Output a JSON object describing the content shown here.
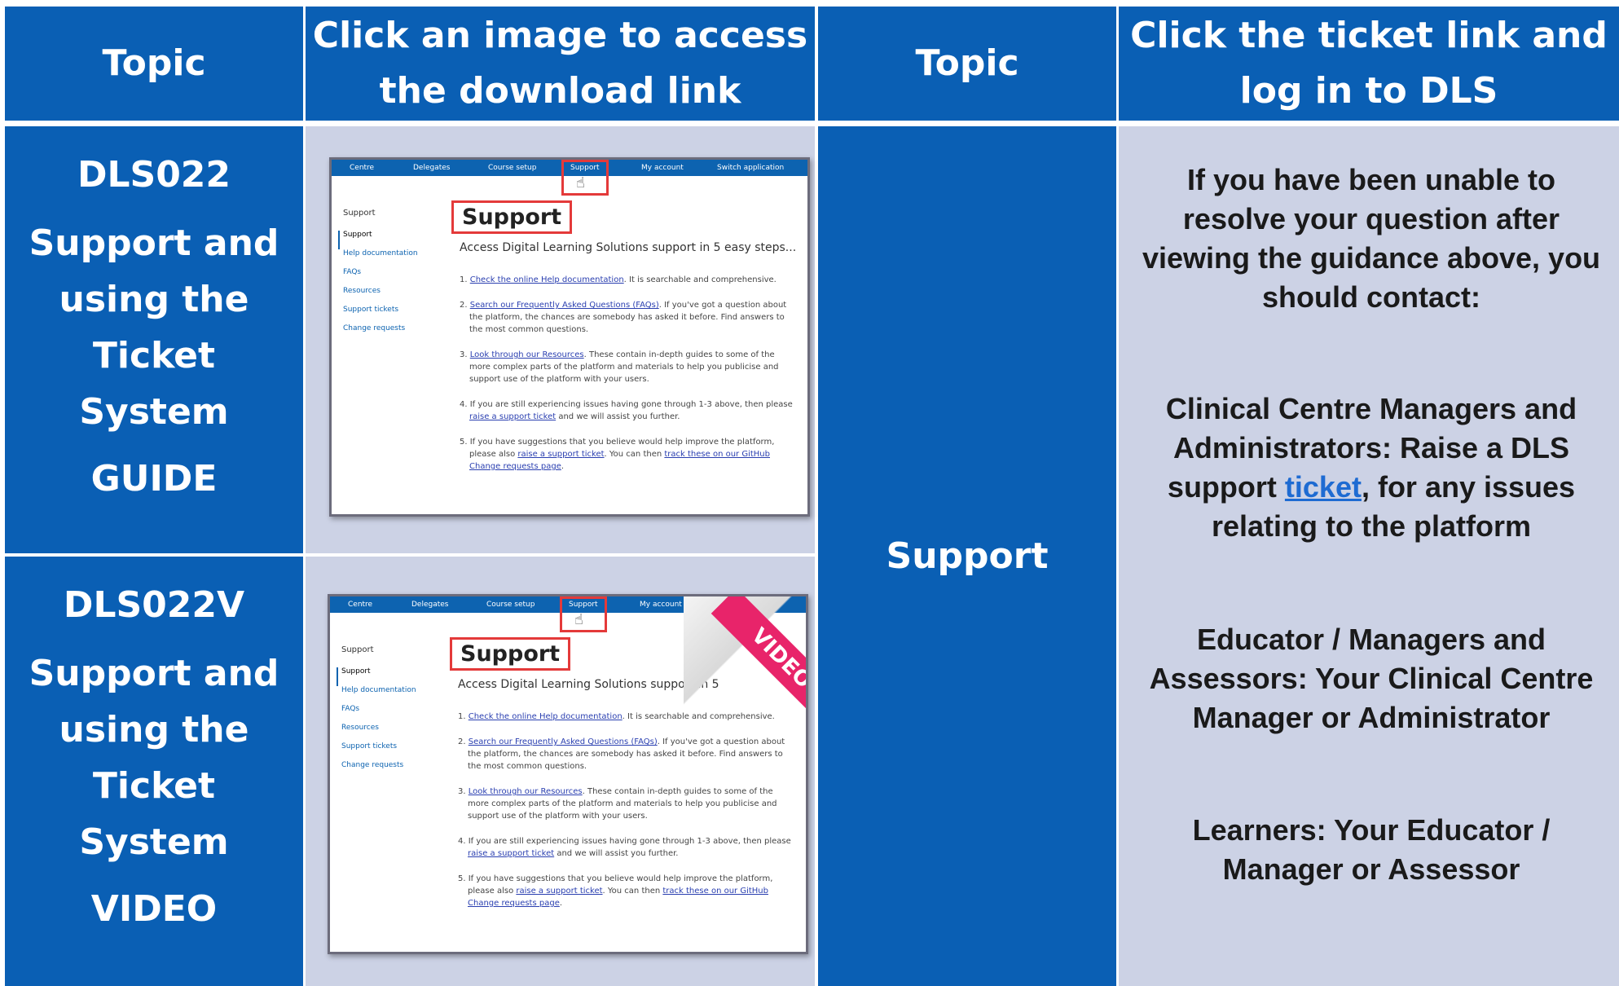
{
  "header": {
    "col1": "Topic",
    "col2": "Click an image to access the download link",
    "col3": "Topic",
    "col4": "Click the ticket link and log in to DLS"
  },
  "rows": [
    {
      "code": "DLS022",
      "title": "Support and using the Ticket System",
      "kind": "GUIDE"
    },
    {
      "code": "DLS022V",
      "title": "Support and using the Ticket System",
      "kind": "VIDEO"
    }
  ],
  "support_topic": "Support",
  "thumbnail": {
    "nav": [
      "Centre",
      "Delegates",
      "Course setup",
      "Support",
      "My account",
      "Switch application"
    ],
    "side_heading": "Support",
    "side_items": [
      "Support",
      "Help documentation",
      "FAQs",
      "Resources",
      "Support tickets",
      "Change requests"
    ],
    "page_title": "Support",
    "intro": "Access Digital Learning Solutions support in 5 easy steps...",
    "intro_video": "Access Digital Learning Solutions support in 5",
    "steps": [
      {
        "link": "Check the online Help documentation",
        "text": ". It is searchable and comprehensive."
      },
      {
        "link": "Search our Frequently Asked Questions (FAQs)",
        "text": ". If you've got a question about the platform, the chances are somebody has asked it before. Find answers to the most common questions."
      },
      {
        "link": "Look through our Resources",
        "text": ". These contain in-depth guides to some of the more complex parts of the platform and materials to help you publicise and support use of the platform with your users."
      },
      {
        "prefix": "If you are still experiencing issues having gone through 1-3 above, then please ",
        "link": "raise a support ticket",
        "text": " and we will assist you further."
      },
      {
        "prefix": "If you have suggestions that you believe would help improve the platform, please also ",
        "link": "raise a support ticket",
        "text": ". You can then ",
        "link2": "track these on our GitHub Change requests page",
        "text2": "."
      }
    ],
    "badge": "VIDEO"
  },
  "contact": {
    "intro": "If you have been unable to resolve your question after viewing the guidance above, you should contact:",
    "p2_before": "Clinical Centre Managers and Administrators: Raise a DLS support ",
    "p2_link": "ticket",
    "p2_after": ", for any issues relating to the platform",
    "p3": "Educator / Managers and Assessors: Your Clinical Centre Manager or Administrator",
    "p4": "Learners: Your Educator / Manager or Assessor"
  },
  "colors": {
    "header_blue": "#0a5fb4",
    "cell_lavender": "#ccd2e5",
    "highlight_red": "#e43a3a",
    "badge_pink": "#e8246a",
    "link_blue": "#1e6bd2"
  }
}
